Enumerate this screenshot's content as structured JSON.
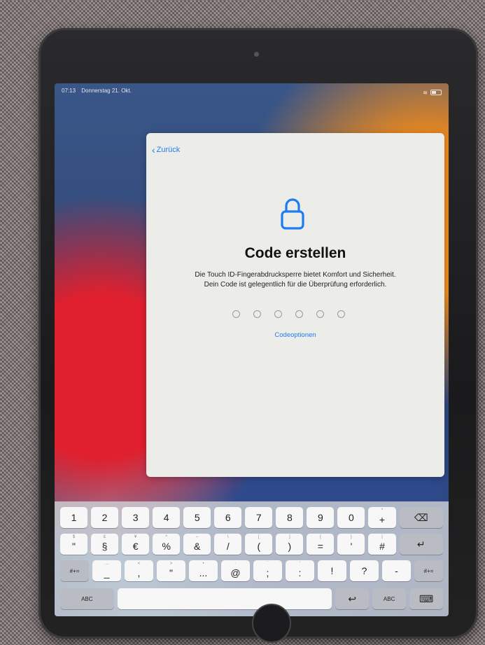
{
  "status_bar": {
    "time": "07:13",
    "date": "Donnerstag 21. Okt."
  },
  "sheet": {
    "back_label": "Zurück",
    "title": "Code erstellen",
    "description": "Die Touch ID-Fingerabdrucksperre bietet Komfort und Sicherheit. Dein Code ist gelegentlich für die Überprüfung erforderlich.",
    "code_length": 6,
    "code_entered": 0,
    "code_options_label": "Codeoptionen"
  },
  "keyboard": {
    "row1": [
      {
        "main": "1",
        "hint": ""
      },
      {
        "main": "2",
        "hint": ""
      },
      {
        "main": "3",
        "hint": ""
      },
      {
        "main": "4",
        "hint": ""
      },
      {
        "main": "5",
        "hint": ""
      },
      {
        "main": "6",
        "hint": ""
      },
      {
        "main": "7",
        "hint": ""
      },
      {
        "main": "8",
        "hint": ""
      },
      {
        "main": "9",
        "hint": ""
      },
      {
        "main": "0",
        "hint": ""
      },
      {
        "main": "+",
        "hint": "*"
      }
    ],
    "row2": [
      {
        "main": "\"",
        "hint": "$"
      },
      {
        "main": "§",
        "hint": "£"
      },
      {
        "main": "€",
        "hint": "¥"
      },
      {
        "main": "%",
        "hint": "^"
      },
      {
        "main": "&",
        "hint": "–"
      },
      {
        "main": "/",
        "hint": "\\"
      },
      {
        "main": "(",
        "hint": "["
      },
      {
        "main": ")",
        "hint": "]"
      },
      {
        "main": "=",
        "hint": "{"
      },
      {
        "main": "'",
        "hint": "}"
      },
      {
        "main": "#",
        "hint": "|"
      }
    ],
    "row3": [
      {
        "main": "_",
        "hint": "…"
      },
      {
        "main": ",",
        "hint": "<"
      },
      {
        "main": "\"",
        "hint": ">"
      },
      {
        "main": "...",
        "hint": "•"
      },
      {
        "main": "@",
        "hint": "·"
      },
      {
        "main": ";",
        "hint": "`"
      },
      {
        "main": ":",
        "hint": "'"
      },
      {
        "main": "!",
        "hint": ""
      },
      {
        "main": "?",
        "hint": ""
      },
      {
        "main": "-",
        "hint": ""
      }
    ],
    "symbols_key": "#+=",
    "abc_key": "ABC"
  },
  "colors": {
    "accent": "#1e7cf2"
  }
}
